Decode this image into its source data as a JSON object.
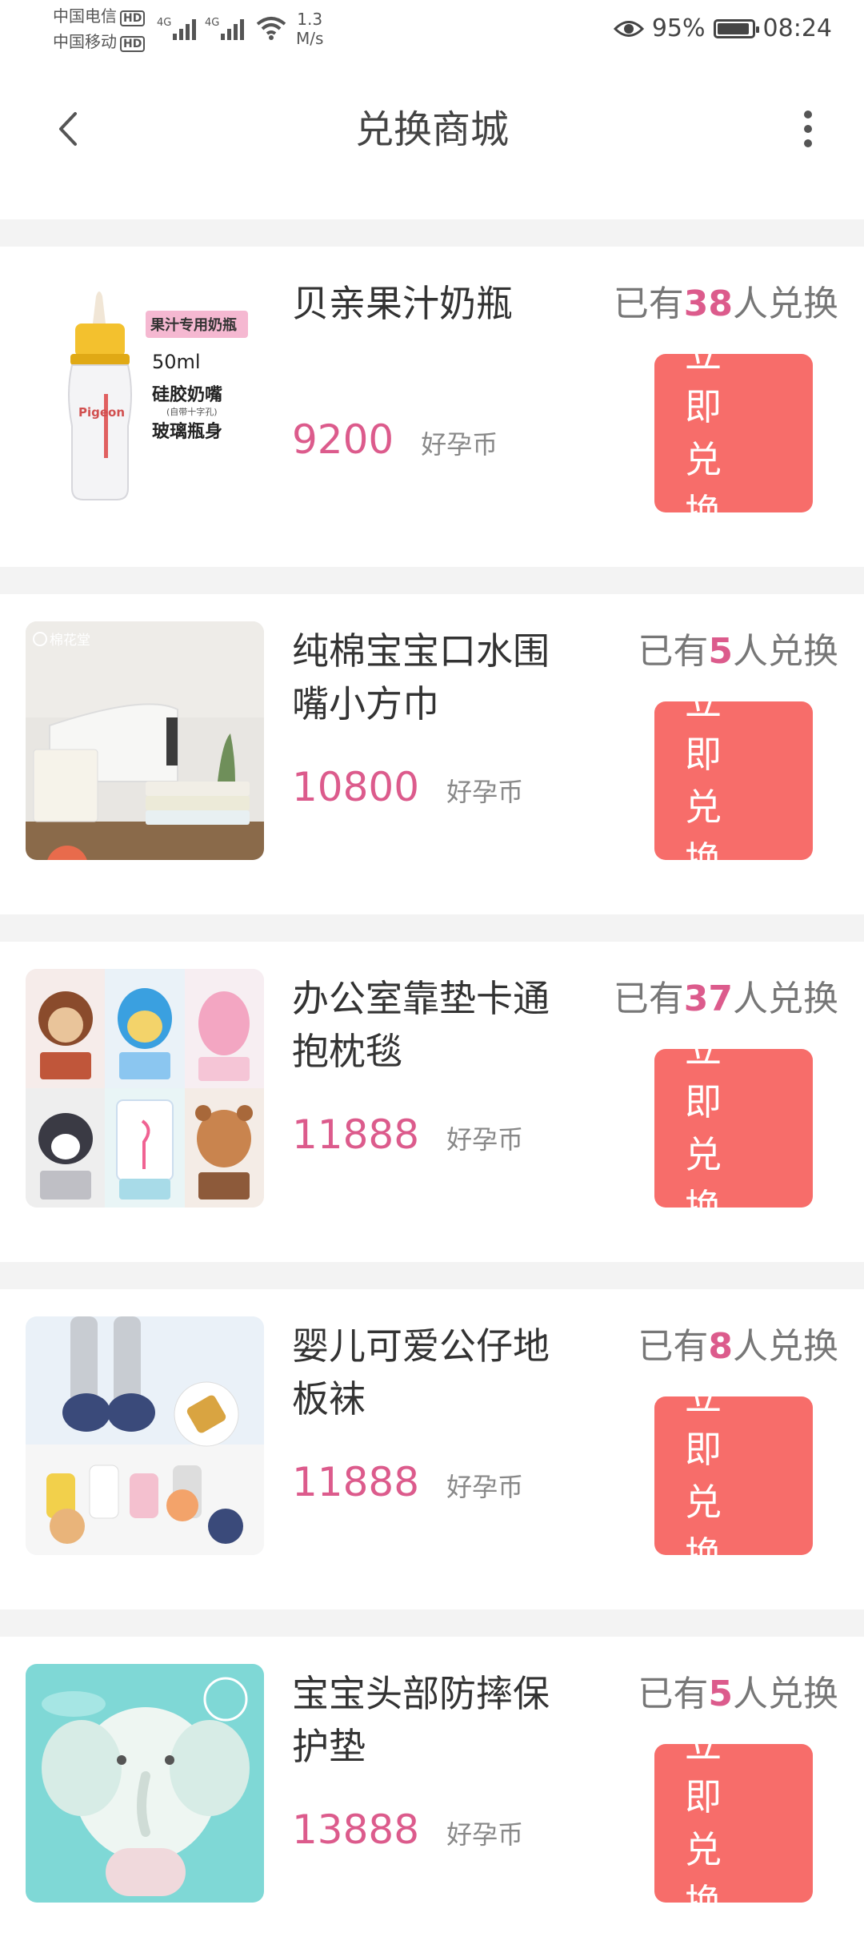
{
  "status": {
    "carrier1": "中国电信",
    "carrier2": "中国移动",
    "hd": "HD",
    "net_speed_value": "1.3",
    "net_speed_unit": "M/s",
    "battery": "95%",
    "battery_level": 0.95,
    "time": "08:24",
    "signal_label": "4G"
  },
  "header": {
    "title": "兑换商城"
  },
  "labels": {
    "count_prefix": "已有",
    "count_suffix": "人兑换",
    "redeem_line1": "立 即",
    "redeem_line2": "兑 换"
  },
  "items": [
    {
      "name": "贝亲果汁奶瓶",
      "price": "9200",
      "unit": "好孕币",
      "count": "38",
      "img_tags": [
        "果汁专用奶瓶",
        "50ml",
        "硅胶奶嘴",
        "(自带十字孔)",
        "玻璃瓶身",
        "Pigeon"
      ]
    },
    {
      "name": "纯棉宝宝口水围嘴小方巾",
      "price": "10800",
      "unit": "好孕币",
      "count": "5",
      "img_tags": [
        "棉花堂"
      ]
    },
    {
      "name": "办公室靠垫卡通抱枕毯",
      "price": "11888",
      "unit": "好孕币",
      "count": "37",
      "img_tags": []
    },
    {
      "name": "婴儿可爱公仔地板袜",
      "price": "11888",
      "unit": "好孕币",
      "count": "8",
      "img_tags": []
    },
    {
      "name": "宝宝头部防摔保护垫",
      "price": "13888",
      "unit": "好孕币",
      "count": "5",
      "img_tags": []
    }
  ],
  "colors": {
    "accent": "#dc5b8c",
    "button": "#f76d6a",
    "divider": "#f3f3f3"
  }
}
